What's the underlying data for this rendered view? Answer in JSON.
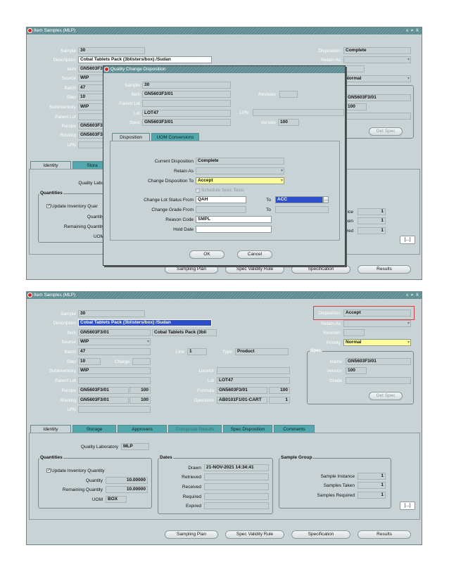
{
  "top": {
    "title": "Item Samples (MLP)",
    "controls": "≤ ≠ X",
    "labels": {
      "sample": "Sample",
      "description": "Description",
      "item": "Item",
      "source": "Source",
      "batch": "Batch",
      "step": "Step",
      "subinventory": "Subinventory",
      "parent_lot": "Parent Lot",
      "recipe": "Recipe",
      "routing": "Routing",
      "lpn": "LPN",
      "disposition": "Disposition",
      "retain_as": "Retain As"
    },
    "values": {
      "sample": "30",
      "description": "Cobal Tablets Pack (3blisters/box) /Sudan",
      "item": "GN5603F3",
      "source": "WIP",
      "batch": "47",
      "step": "10",
      "subinventory": "WIP",
      "recipe": "GN5603F3",
      "routing": "GN5603F3",
      "disposition": "Complete",
      "priority": "Normal",
      "spec_name": "GN5603F3/01",
      "spec_version": "100"
    },
    "get_spec": "Get Spec",
    "tabs": [
      "Identity",
      "Stora"
    ],
    "quality_lab_label": "Quality Labor",
    "quantities_title": "Quantities",
    "update_inventory": "Update Inventory Quar",
    "quantity_label": "Quantity",
    "remaining_label": "Remaining Quantity",
    "uom_label": "UOM",
    "right_labels": [
      "ice",
      "ken",
      "red"
    ],
    "right_values": [
      "1",
      "1",
      "1"
    ],
    "buttons": {
      "sampling_plan": "Sampling Plan",
      "spec_validity": "Spec Validity Rule",
      "specification": "Specification",
      "results": "Results"
    },
    "more_btn": "[...]"
  },
  "dialog": {
    "title": "Quality Change Disposition",
    "labels": {
      "sample": "Sample",
      "item": "Item",
      "parent_lot": "Parent Lot",
      "lot": "Lot",
      "spec": "Spec",
      "revision": "Revision",
      "lpn": "LPN",
      "version": "Version"
    },
    "values": {
      "sample": "30",
      "item": "GN5603F3/01",
      "lot": "LOT47",
      "spec": "GN5603F3/01",
      "version": "100"
    },
    "tabs": [
      "Disposition",
      "UOM Conversions"
    ],
    "current_disposition_label": "Current Disposition",
    "current_disposition": "Complete",
    "retain_as_label": "Retain As",
    "change_to_label": "Change Disposition To",
    "change_to": "Accept",
    "schedule_spec_tests": "Schedule Spec Tests",
    "lot_status_label": "Change Lot Status From",
    "lot_status_from": "QAH",
    "to_label": "To",
    "lot_status_to": "ACC",
    "grade_label": "Change Grade From",
    "reason_label": "Reason Code",
    "reason": "SMPL",
    "hold_label": "Hold Date",
    "ok": "OK",
    "cancel": "Cancel"
  },
  "bottom": {
    "title": "Item Samples (MLP)",
    "controls": "≤ ≠ X",
    "labels": {
      "sample": "Sample",
      "description": "Description",
      "item": "Item",
      "source": "Source",
      "batch": "Batch",
      "step": "Step",
      "charge": "Charge",
      "subinventory": "Subinventory",
      "parent_lot": "Parent Lot",
      "recipe": "Recipe",
      "routing": "Routing",
      "lpn": "LPN",
      "line": "Line",
      "type": "Type",
      "locator": "Locator",
      "lot": "Lot",
      "formula": "Formula",
      "operation": "Operation",
      "disposition": "Disposition",
      "retain_as": "Retain As",
      "revision": "Revision",
      "priority": "Priority",
      "spec": "Spec",
      "name": "Name",
      "version": "Version",
      "grade": "Grade"
    },
    "values": {
      "sample": "30",
      "description": "Cobal Tablets Pack (3blisters/box) /Sudan",
      "item": "GN5603F3/01",
      "item_desc": "Cobal Tablets Pack (3bli",
      "source": "WIP",
      "batch": "47",
      "step": "10",
      "subinventory": "WIP",
      "recipe": "GN5603F3/01",
      "recipe_ver": "100",
      "routing": "GN5603F3/01",
      "routing_ver": "100",
      "line": "1",
      "type": "Product",
      "lot": "LOT47",
      "formula": "GN5603F3/01",
      "formula_ver": "100",
      "operation": "AB0101F1/01-CART",
      "operation_ver": "1",
      "disposition": "Accept",
      "priority": "Normal",
      "spec_name": "GN5603F3/01",
      "spec_version": "100"
    },
    "get_spec": "Get Spec",
    "tabs": [
      "Identity",
      "Storage",
      "Approvers",
      "Composite Results",
      "Spec Disposition",
      "Comments"
    ],
    "quality_lab_label": "Quality Laboratory",
    "quality_lab": "MLP",
    "quantities_title": "Quantities",
    "update_inventory": "Update Inventory Quantity",
    "quantity_label": "Quantity",
    "quantity": "10.00000",
    "remaining_label": "Remaining Quantity",
    "remaining": "10.00000",
    "uom_label": "UOM",
    "uom": "BOX",
    "dates_title": "Dates",
    "drawn_label": "Drawn",
    "drawn": "21-NOV-2021 14:34:41",
    "retrieved_label": "Retrieved",
    "received_label": "Received",
    "required_label": "Required",
    "expired_label": "Expired",
    "sample_group_title": "Sample Group",
    "sample_instance_label": "Sample Instance",
    "sample_instance": "1",
    "samples_taken_label": "Samples Taken",
    "samples_taken": "1",
    "samples_required_label": "Samples Required",
    "samples_required": "1",
    "buttons": {
      "sampling_plan": "Sampling Plan",
      "spec_validity": "Spec Validity Rule",
      "specification": "Specification",
      "results": "Results"
    },
    "more_btn": "[...]"
  },
  "colors": {
    "window_bg": "#c9d3d6",
    "title_bg": "#5c8c92",
    "tab_bg": "#52a8ac",
    "highlight_yellow": "#ffff99",
    "selection_blue": "#2c4ec8",
    "annotation_red": "#d0433a"
  }
}
